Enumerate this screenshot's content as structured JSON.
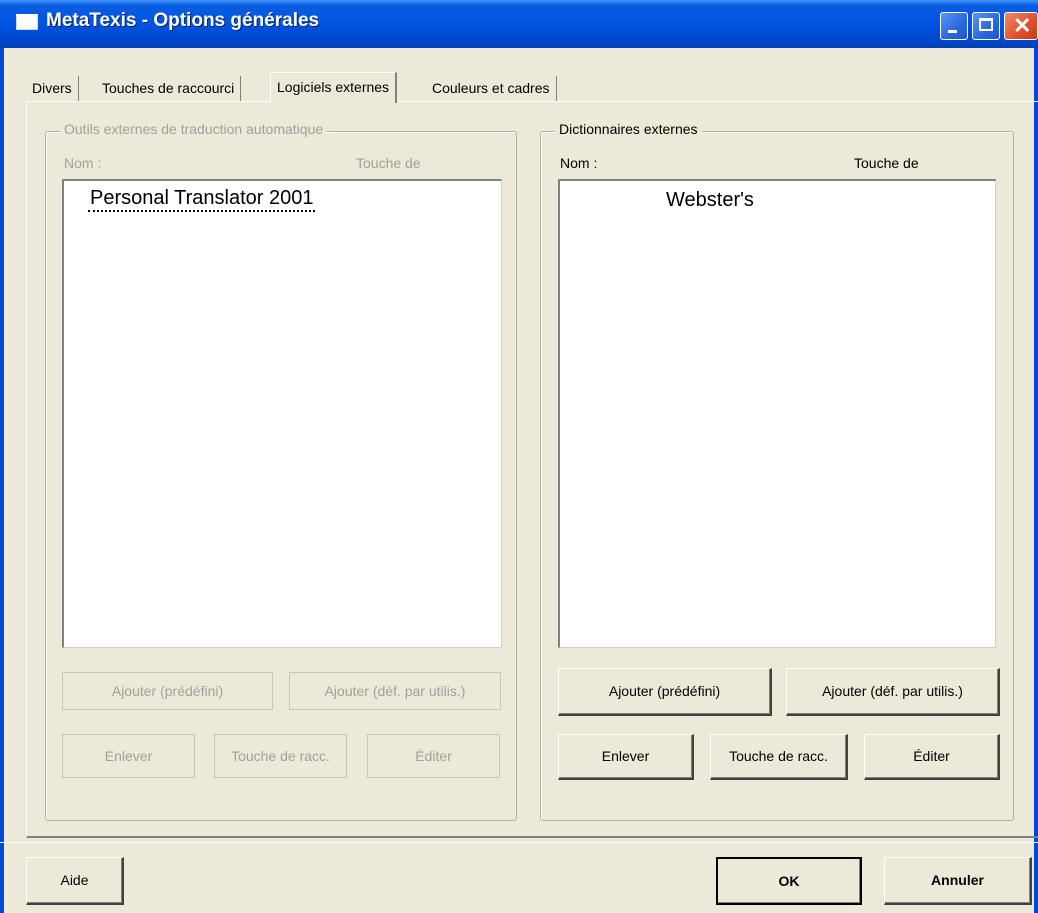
{
  "window": {
    "title": "MetaTexis - Options générales",
    "controls": [
      "minimize",
      "maximize",
      "close"
    ],
    "title_color": "#0054e3",
    "background": "#ece9d8"
  },
  "tabs": [
    {
      "label": "Divers",
      "active": false
    },
    {
      "label": "Touches de raccourci",
      "active": false
    },
    {
      "label": "Logiciels externes",
      "active": true
    },
    {
      "label": "Couleurs et cadres",
      "active": false
    }
  ],
  "left_group": {
    "legend": "Outils externes de traduction automatique",
    "enabled": false,
    "col_name": "Nom :",
    "col_key": "Touche de",
    "items": [
      {
        "name": "Personal Translator 2001"
      }
    ],
    "buttons": {
      "add_predefined": "Ajouter (prédéfini)",
      "add_user": "Ajouter (déf. par utilis.)",
      "remove": "Enlever",
      "shortcut": "Touche de racc.",
      "edit": "Éditer"
    }
  },
  "right_group": {
    "legend": "Dictionnaires externes",
    "enabled": true,
    "col_name": "Nom :",
    "col_key": "Touche de",
    "items": [
      {
        "name": "Webster's"
      }
    ],
    "buttons": {
      "add_predefined": "Ajouter (prédéfini)",
      "add_user": "Ajouter (déf. par utilis.)",
      "remove": "Enlever",
      "shortcut": "Touche de racc.",
      "edit": "Éditer"
    }
  },
  "footer": {
    "help": "Aide",
    "ok": "OK",
    "cancel": "Annuler"
  },
  "icons": [
    "window-app-icon",
    "minimize-icon",
    "maximize-icon",
    "close-icon"
  ]
}
